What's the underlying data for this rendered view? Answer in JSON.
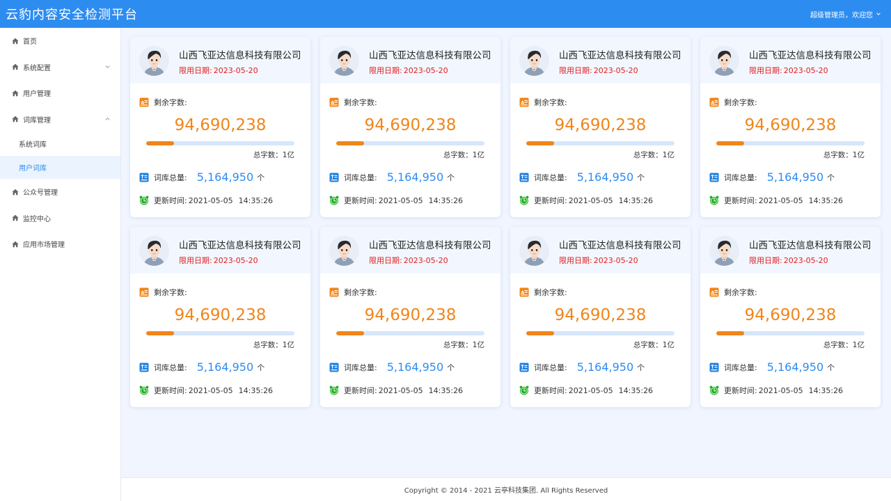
{
  "app": {
    "title": "云豹内容安全检测平台"
  },
  "header": {
    "user_greeting": "超级管理员，欢迎您"
  },
  "sidebar": {
    "items": [
      {
        "label": "首页"
      },
      {
        "label": "系统配置"
      },
      {
        "label": "用户管理"
      },
      {
        "label": "词库管理"
      },
      {
        "label": "系统词库"
      },
      {
        "label": "用户词库"
      },
      {
        "label": "公众号管理"
      },
      {
        "label": "监控中心"
      },
      {
        "label": "应用市场管理"
      }
    ],
    "active_item": "用户词库"
  },
  "cards": [
    {
      "company": "山西飞亚达信息科技有限公司",
      "limit_label": "限用日期:",
      "limit_date": "2023-05-20",
      "remain_label": "剩余字数:",
      "remain_value": "94,690,238",
      "progress": 0.19,
      "total_label": "总字数：1亿",
      "lib_label": "词库总量:",
      "lib_value": "5,164,950",
      "lib_unit": "个",
      "update_label": "更新时间:",
      "update_date": "2021-05-05",
      "update_time": "14:35:26"
    },
    {
      "company": "山西飞亚达信息科技有限公司",
      "limit_label": "限用日期:",
      "limit_date": "2023-05-20",
      "remain_label": "剩余字数:",
      "remain_value": "94,690,238",
      "progress": 0.19,
      "total_label": "总字数：1亿",
      "lib_label": "词库总量:",
      "lib_value": "5,164,950",
      "lib_unit": "个",
      "update_label": "更新时间:",
      "update_date": "2021-05-05",
      "update_time": "14:35:26"
    },
    {
      "company": "山西飞亚达信息科技有限公司",
      "limit_label": "限用日期:",
      "limit_date": "2023-05-20",
      "remain_label": "剩余字数:",
      "remain_value": "94,690,238",
      "progress": 0.19,
      "total_label": "总字数：1亿",
      "lib_label": "词库总量:",
      "lib_value": "5,164,950",
      "lib_unit": "个",
      "update_label": "更新时间:",
      "update_date": "2021-05-05",
      "update_time": "14:35:26"
    },
    {
      "company": "山西飞亚达信息科技有限公司",
      "limit_label": "限用日期:",
      "limit_date": "2023-05-20",
      "remain_label": "剩余字数:",
      "remain_value": "94,690,238",
      "progress": 0.19,
      "total_label": "总字数：1亿",
      "lib_label": "词库总量:",
      "lib_value": "5,164,950",
      "lib_unit": "个",
      "update_label": "更新时间:",
      "update_date": "2021-05-05",
      "update_time": "14:35:26"
    },
    {
      "company": "山西飞亚达信息科技有限公司",
      "limit_label": "限用日期:",
      "limit_date": "2023-05-20",
      "remain_label": "剩余字数:",
      "remain_value": "94,690,238",
      "progress": 0.19,
      "total_label": "总字数：1亿",
      "lib_label": "词库总量:",
      "lib_value": "5,164,950",
      "lib_unit": "个",
      "update_label": "更新时间:",
      "update_date": "2021-05-05",
      "update_time": "14:35:26"
    },
    {
      "company": "山西飞亚达信息科技有限公司",
      "limit_label": "限用日期:",
      "limit_date": "2023-05-20",
      "remain_label": "剩余字数:",
      "remain_value": "94,690,238",
      "progress": 0.19,
      "total_label": "总字数：1亿",
      "lib_label": "词库总量:",
      "lib_value": "5,164,950",
      "lib_unit": "个",
      "update_label": "更新时间:",
      "update_date": "2021-05-05",
      "update_time": "14:35:26"
    },
    {
      "company": "山西飞亚达信息科技有限公司",
      "limit_label": "限用日期:",
      "limit_date": "2023-05-20",
      "remain_label": "剩余字数:",
      "remain_value": "94,690,238",
      "progress": 0.19,
      "total_label": "总字数：1亿",
      "lib_label": "词库总量:",
      "lib_value": "5,164,950",
      "lib_unit": "个",
      "update_label": "更新时间:",
      "update_date": "2021-05-05",
      "update_time": "14:35:26"
    },
    {
      "company": "山西飞亚达信息科技有限公司",
      "limit_label": "限用日期:",
      "limit_date": "2023-05-20",
      "remain_label": "剩余字数:",
      "remain_value": "94,690,238",
      "progress": 0.19,
      "total_label": "总字数：1亿",
      "lib_label": "词库总量:",
      "lib_value": "5,164,950",
      "lib_unit": "个",
      "update_label": "更新时间:",
      "update_date": "2021-05-05",
      "update_time": "14:35:26"
    }
  ],
  "footer": {
    "copyright": "Copyright © 2014 - 2021 云亭科技集团. All Rights Reserved"
  },
  "icons": {
    "home": "home-icon",
    "chevron_down": "chevron-down-icon",
    "chevron_up": "chevron-up-icon",
    "remain": "text-count-icon",
    "library": "word-library-icon",
    "update": "alarm-clock-icon",
    "avatar": "avatar"
  },
  "colors": {
    "brand": "#2d8cf0",
    "accent": "#f08519",
    "danger": "#e02020",
    "clock": "#19b21d",
    "background": "#f0f5ff"
  }
}
